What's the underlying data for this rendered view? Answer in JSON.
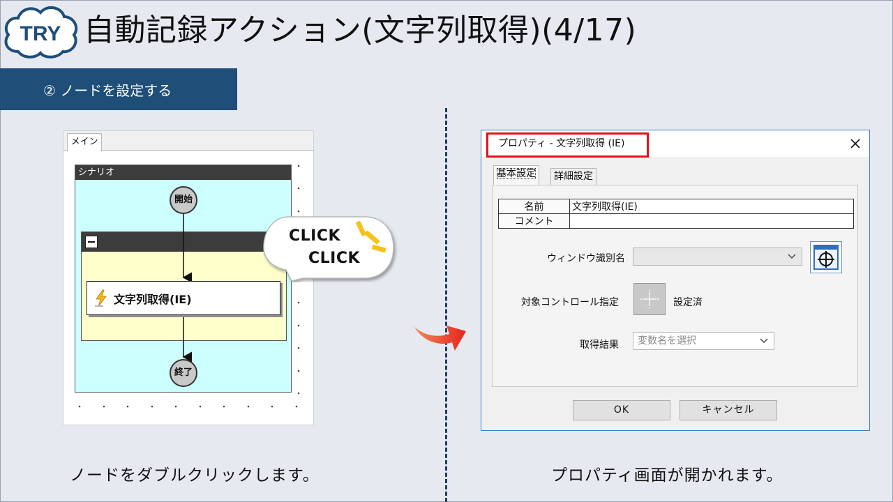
{
  "header": {
    "badge": "TRY",
    "title": "自動記録アクション(文字列取得)(4/17)",
    "step": "② ノードを設定する"
  },
  "left_panel": {
    "tab": "メイン",
    "scenario_label": "シナリオ",
    "start_node": "開始",
    "end_node": "終了",
    "action_node": "文字列取得(IE)",
    "click_text_1": "CLICK",
    "click_text_2": "CLICK",
    "caption": "ノードをダブルクリックします。"
  },
  "dialog": {
    "title": "プロパティ - 文字列取得 (IE)",
    "tabs": [
      "基本設定",
      "詳細設定"
    ],
    "table": [
      {
        "key": "名前",
        "value": "文字列取得(IE)"
      },
      {
        "key": "コメント",
        "value": ""
      }
    ],
    "window_id_label": "ウィンドウ識別名",
    "window_id_value": "",
    "target_label": "対象コントロール指定",
    "target_status": "設定済",
    "result_label": "取得結果",
    "result_placeholder": "変数名を選択",
    "ok_label": "OK",
    "cancel_label": "キャンセル"
  },
  "right_caption": "プロパティ画面が開かれます。",
  "colors": {
    "banner": "#1f4e79",
    "scenario_bg": "#ccffff",
    "group_bg": "#ffffcc",
    "highlight": "#e0131a",
    "dialog_border": "#3a7fc4"
  }
}
